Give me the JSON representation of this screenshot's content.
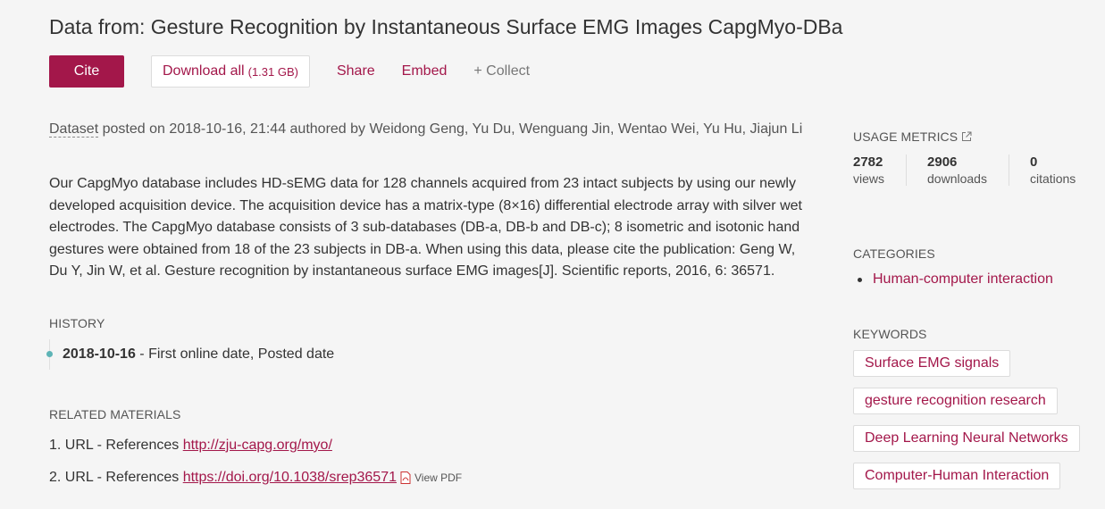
{
  "title": "Data from: Gesture Recognition by Instantaneous Surface EMG Images CapgMyo-DBa",
  "toolbar": {
    "cite": "Cite",
    "download": "Download all",
    "download_size": "(1.31 GB)",
    "share": "Share",
    "embed": "Embed",
    "collect": "+ Collect"
  },
  "byline": {
    "type": "Dataset",
    "posted": " posted on 2018-10-16, 21:44 authored by Weidong Geng, Yu Du, Wenguang Jin, Wentao Wei, Yu Hu, Jiajun Li"
  },
  "description": "Our CapgMyo database includes HD-sEMG data for 128 channels acquired from 23 intact subjects by using our newly developed acquisition device. The acquisition device has a matrix-type (8×16) differential electrode array with silver wet electrodes. The CapgMyo database consists of 3 sub-databases (DB-a, DB-b and DB-c); 8 isometric and isotonic hand gestures were obtained from 18 of the 23 subjects in DB-a. When using this data, please cite the publication: Geng W, Du Y, Jin W, et al. Gesture recognition by instantaneous surface EMG images[J]. Scientific reports, 2016, 6: 36571.",
  "history": {
    "heading": "HISTORY",
    "date": "2018-10-16",
    "text": " - First online date, Posted date"
  },
  "related": {
    "heading": "RELATED MATERIALS",
    "items": [
      {
        "num": "1.",
        "label": "URL - References ",
        "url": "http://zju-capg.org/myo/"
      },
      {
        "num": "2.",
        "label": "URL - References ",
        "url": "https://doi.org/10.1038/srep36571",
        "extra": "View PDF"
      }
    ]
  },
  "usage": {
    "heading": "USAGE METRICS",
    "metrics": [
      {
        "value": "2782",
        "label": "views"
      },
      {
        "value": "2906",
        "label": "downloads"
      },
      {
        "value": "0",
        "label": "citations"
      }
    ]
  },
  "categories": {
    "heading": "CATEGORIES",
    "items": [
      "Human-computer interaction"
    ]
  },
  "keywords": {
    "heading": "KEYWORDS",
    "items": [
      "Surface EMG signals",
      "gesture recognition research",
      "Deep Learning Neural Networks",
      "Computer-Human Interaction"
    ]
  },
  "colors": {
    "accent": "#a3174a",
    "background": "#f5f5f5",
    "history_dot": "#5db4b6"
  }
}
